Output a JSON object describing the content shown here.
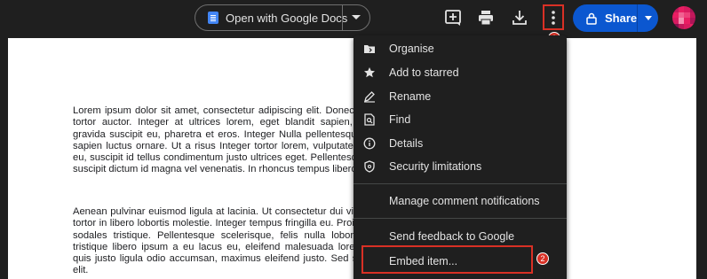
{
  "toolbar": {
    "open_with_label": "Open with Google Docs",
    "share_label": "Share",
    "icons": {
      "add_comment": "add-comment-icon",
      "print": "print-icon",
      "download": "download-icon",
      "more": "more-vert-icon"
    }
  },
  "annotations": {
    "step1": "1",
    "step2": "2",
    "highlight_color": "#d93025"
  },
  "document": {
    "paragraph1": "Lorem ipsum dolor sit amet, consectetur adipiscing elit. Donec eget cursus tortor auctor. Integer at ultrices lorem, eget blandit sapien, ullamcorper gravida suscipit eu, pharetra et eros. Integer Nulla pellentesque ante vitae sapien luctus ornare. Ut a risus Integer tortor lorem, vulputate non tempus eu, suscipit id tellus condimentum justo ultrices eget. Pellentesque hendrerit suscipit dictum id magna vel venenatis. In rhoncus tempus libero, sed cursus",
    "paragraph2": "Aenean pulvinar euismod ligula at lacinia. Ut consectetur dui vitae. In mollis tortor in libero lobortis molestie. Integer tempus fringilla eu. Proin vestibulum sodales tristique. Pellentesque scelerisque, felis nulla lobortis tellus, at tristique libero ipsum a eu lacus eu, eleifend malesuada lorem. Praesent quis justo ligula odio accumsan, maximus eleifend justo. Sed sed convallis elit."
  },
  "menu": {
    "items": [
      {
        "label": "Organise",
        "icon": "organise-folder-icon"
      },
      {
        "label": "Add to starred",
        "icon": "star-icon"
      },
      {
        "label": "Rename",
        "icon": "rename-pencil-icon"
      },
      {
        "label": "Find",
        "icon": "find-in-page-icon"
      },
      {
        "label": "Details",
        "icon": "info-icon"
      },
      {
        "label": "Security limitations",
        "icon": "security-shield-icon"
      },
      {
        "label": "Manage comment notifications",
        "icon": ""
      },
      {
        "label": "Send feedback to Google",
        "icon": ""
      },
      {
        "label": "Embed item...",
        "icon": ""
      }
    ]
  },
  "colors": {
    "share_blue": "#0b57d0",
    "background": "#1f1f1f",
    "docs_blue": "#4285f4"
  }
}
